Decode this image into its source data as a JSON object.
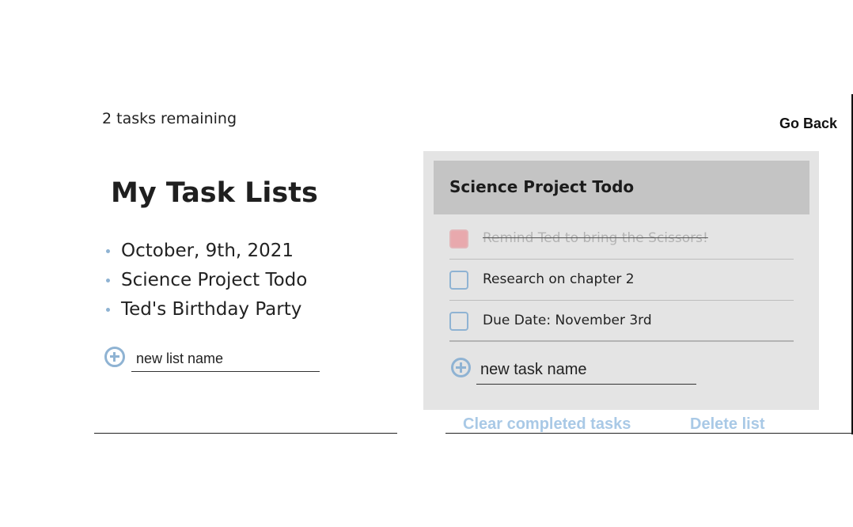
{
  "status": {
    "tasks_remaining": "2 tasks remaining"
  },
  "nav": {
    "go_back_label": "Go Back"
  },
  "lists": {
    "title": "My Task Lists",
    "items": [
      {
        "label": "October, 9th, 2021"
      },
      {
        "label": "Science Project Todo"
      },
      {
        "label": "Ted's Birthday Party"
      }
    ],
    "new_list_value": "new list name"
  },
  "active_list": {
    "title": "Science Project Todo",
    "tasks": [
      {
        "label": "Remind Ted to bring the Scissors!",
        "completed": true
      },
      {
        "label": "Research on chapter 2",
        "completed": false
      },
      {
        "label": "Due Date: November 3rd",
        "completed": false
      }
    ],
    "new_task_value": "new task name",
    "clear_completed_label": "Clear completed tasks",
    "delete_list_label": "Delete list"
  },
  "colors": {
    "accent": "#8fb3d3",
    "link": "#a9c9e6",
    "panel_bg": "#e4e4e4",
    "header_bg": "#c4c4c4",
    "completed_checkbox": "#e8a9ad"
  },
  "icons": {
    "add": "plus-circle-icon",
    "bullet": "bullet-dot-icon"
  }
}
